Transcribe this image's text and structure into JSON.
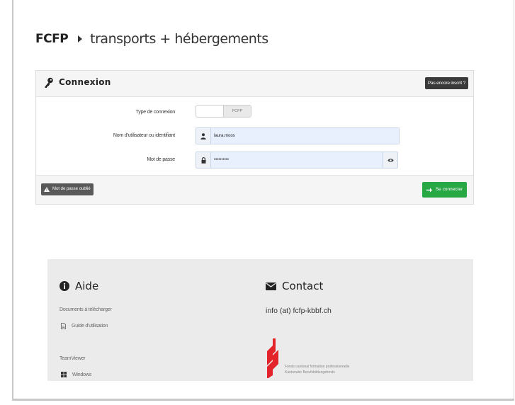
{
  "header": {
    "brand": "FCFP",
    "site_title": "transports + hébergements"
  },
  "login_panel": {
    "title": "Connexion",
    "register_button": "Pas encore inscrit ?",
    "connection_type_label": "Type de connexion",
    "connection_type_value": "FCFP",
    "username_label": "Nom d'utilisateur ou identifiant",
    "username_value": "laura.moos",
    "password_label": "Mot de passe",
    "password_value": "••••••••••",
    "forgot_password_button": "Mot de passe oublié",
    "login_button": "Se connecter"
  },
  "footer": {
    "help_title": "Aide",
    "documents_label": "Documents à télécharger",
    "guide_link": "Guide d'utilisation",
    "teamviewer_label": "TeamViewer",
    "windows_link": "Windows",
    "contact_title": "Contact",
    "contact_email": "info (at) fcfp-kbbf.ch",
    "logo_line1": "Fonds cantonal formation professionnelle",
    "logo_line2": "Kantonaler Berufsbildungsfonds"
  },
  "colors": {
    "accent_green": "#28a745",
    "dark_button": "#3a3a3a",
    "logo_red": "#e3242b"
  }
}
